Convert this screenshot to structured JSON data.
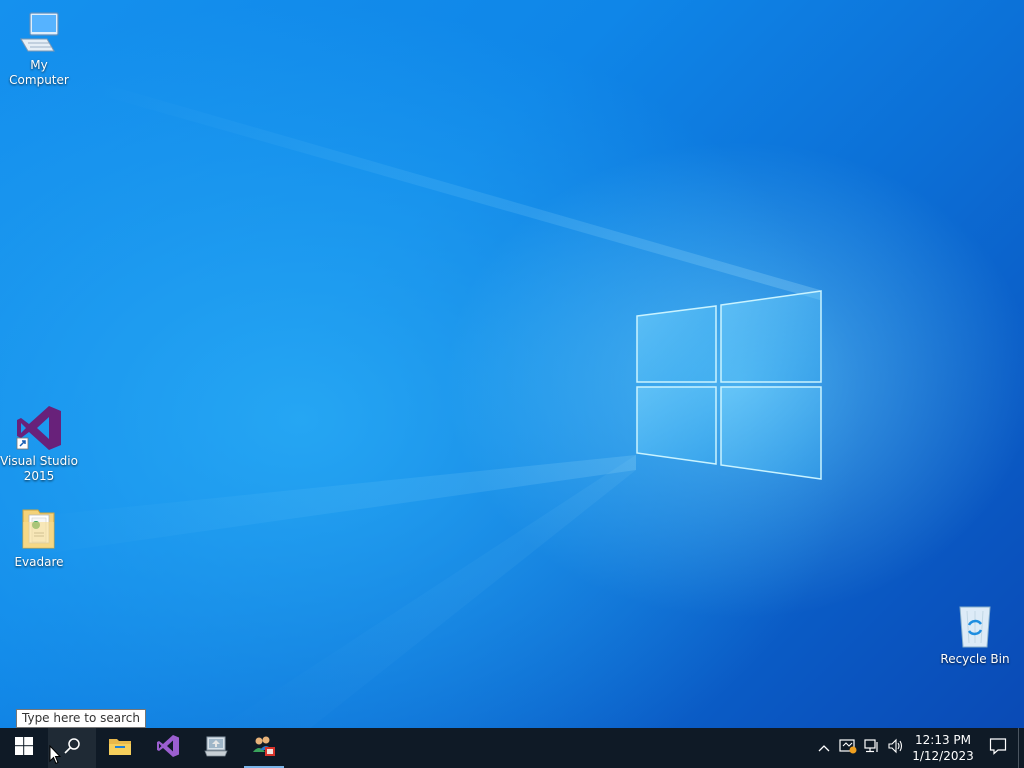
{
  "desktop": {
    "icons": [
      {
        "label": "My Computer",
        "icon": "computer-icon"
      },
      {
        "label": "Visual Studio 2015",
        "icon": "visual-studio-icon"
      },
      {
        "label": "Evadare",
        "icon": "folder-icon"
      },
      {
        "label": "Recycle Bin",
        "icon": "recycle-bin-icon"
      }
    ],
    "wallpaper": {
      "name": "windows-logo-wallpaper",
      "accent": "#0f86e8"
    }
  },
  "taskbar": {
    "search_tooltip": "Type here to search",
    "buttons": [
      {
        "icon": "start-windows-icon"
      },
      {
        "icon": "search-icon"
      },
      {
        "icon": "file-explorer-icon"
      },
      {
        "icon": "visual-studio-icon"
      },
      {
        "icon": "computer-management-icon"
      },
      {
        "icon": "users-app-icon"
      }
    ],
    "tray": {
      "icons": [
        "chevron-up-icon",
        "security-alert-icon",
        "network-icon",
        "volume-icon"
      ],
      "time": "12:13 PM",
      "date": "1/12/2023",
      "notifications_icon": "action-center-icon"
    },
    "background": "#0f1a26"
  }
}
